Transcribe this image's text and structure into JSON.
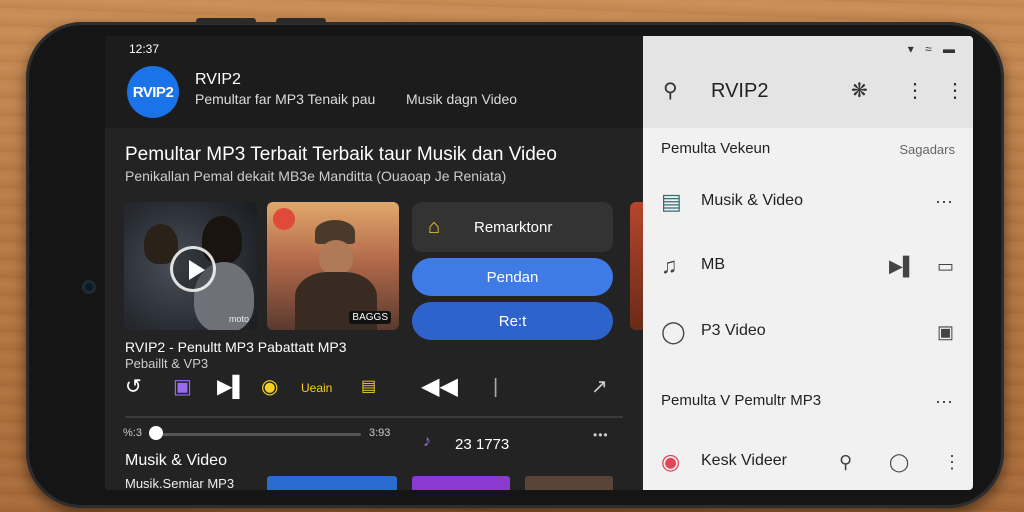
{
  "status_left": "12:37",
  "app_header": {
    "logo": "RVIP2",
    "title": "RVIP2",
    "subtitle_a": "Pemultar far MP3 Tenaik pau",
    "subtitle_b": "Musik dagn Video"
  },
  "hero": {
    "title": "Pemultar MP3 Terbait Terbaik taur Musik dan Video",
    "subtitle": "Penikallan Pemal dekait MB3e Manditta (Ouaoap Je Reniata)"
  },
  "thumbs": {
    "t1_badge": "moto",
    "t1_icon": "play-icon",
    "t2_badge": "BAGGS"
  },
  "buttons": {
    "remark": "Remarktonr",
    "remark_icon": "home-icon",
    "pendan": "Pendan",
    "rest": "Re:t"
  },
  "track": {
    "title": "RVIP2 - Penultt MP3 Pabattatt MP3",
    "subtitle": "Pebaillt & VP3",
    "btn_text": "Ueain"
  },
  "player": {
    "time_elapsed": "%:3",
    "time_total": "3:93",
    "count": "23 1773",
    "more": "•••"
  },
  "section": {
    "title": "Musik & Video",
    "subtitle": "Musik.Semiar MP3"
  },
  "right": {
    "title": "RVIP2",
    "section_left": "Pemulta Vekeun",
    "section_right": "Sagadars",
    "rows": [
      {
        "label": "Musik & Video",
        "icon": "music-folder-icon",
        "right_icon": "grid-dots-icon"
      },
      {
        "label": "MB",
        "icon": "music-note-icon",
        "right_icon": "cast-icon"
      },
      {
        "label": "P3 Video",
        "icon": "timer-icon",
        "right_icon": "square-icon"
      }
    ],
    "heading2": "Pemulta V Pemultr MP3",
    "bottom_row": {
      "label": "Kesk Videer",
      "icon": "record-icon"
    }
  },
  "colors": {
    "accent_blue": "#3f7be6",
    "accent_blue_dark": "#2f63cc",
    "accent_yellow": "#f5d020",
    "accent_purple": "#9a6cf0",
    "dark_bg": "#232323",
    "light_bg": "#f1f1f1"
  }
}
